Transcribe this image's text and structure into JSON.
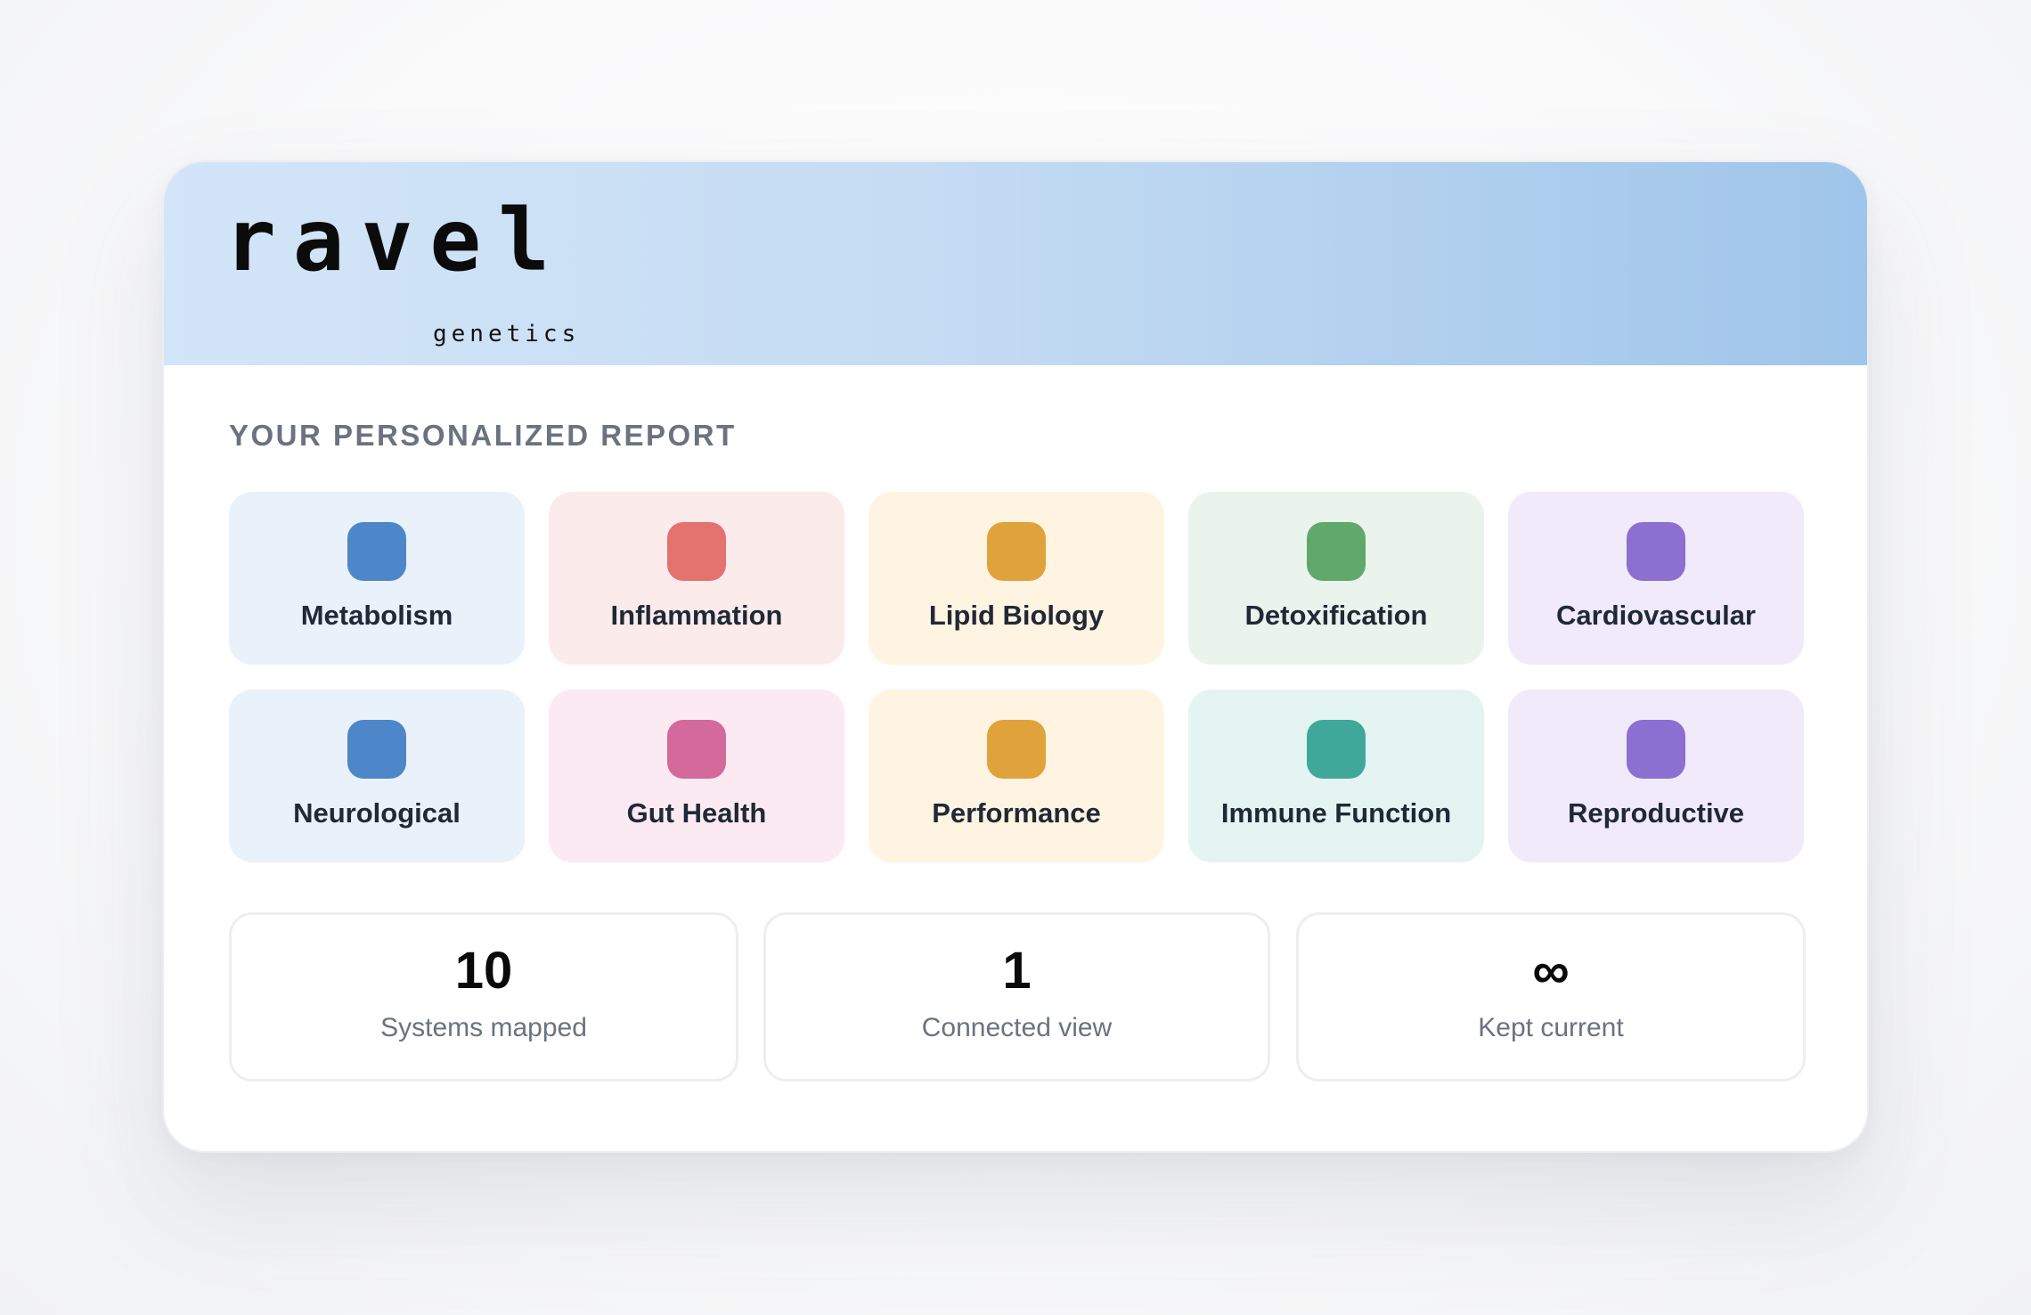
{
  "brand": {
    "name": "ravel",
    "tagline": "genetics"
  },
  "report": {
    "heading": "YOUR PERSONALIZED REPORT",
    "systems": [
      {
        "label": "Metabolism",
        "icon": "metabolism-icon",
        "color": "#4d87c9",
        "bg": "#e9f1fb"
      },
      {
        "label": "Inflammation",
        "icon": "inflammation-icon",
        "color": "#e4726f",
        "bg": "#fcebeb"
      },
      {
        "label": "Lipid Biology",
        "icon": "lipid-biology-icon",
        "color": "#e0a33c",
        "bg": "#fff3e1"
      },
      {
        "label": "Detoxification",
        "icon": "detoxification-icon",
        "color": "#5fa96c",
        "bg": "#eaf4ec"
      },
      {
        "label": "Cardiovascular",
        "icon": "cardiovascular-icon",
        "color": "#8b6fd1",
        "bg": "#f0eafa"
      },
      {
        "label": "Neurological",
        "icon": "neurological-icon",
        "color": "#4d87c9",
        "bg": "#e9f1fb"
      },
      {
        "label": "Gut Health",
        "icon": "gut-health-icon",
        "color": "#d36a9b",
        "bg": "#fbeaf2"
      },
      {
        "label": "Performance",
        "icon": "performance-icon",
        "color": "#e0a33c",
        "bg": "#fff3e1"
      },
      {
        "label": "Immune Function",
        "icon": "immune-function-icon",
        "color": "#3fa89a",
        "bg": "#e3f4f2"
      },
      {
        "label": "Reproductive",
        "icon": "reproductive-icon",
        "color": "#8b6fd1",
        "bg": "#f0eafa"
      }
    ]
  },
  "stats": [
    {
      "value": "10",
      "label": "Systems mapped"
    },
    {
      "value": "1",
      "label": "Connected view"
    },
    {
      "value": "∞",
      "label": "Kept current"
    }
  ]
}
